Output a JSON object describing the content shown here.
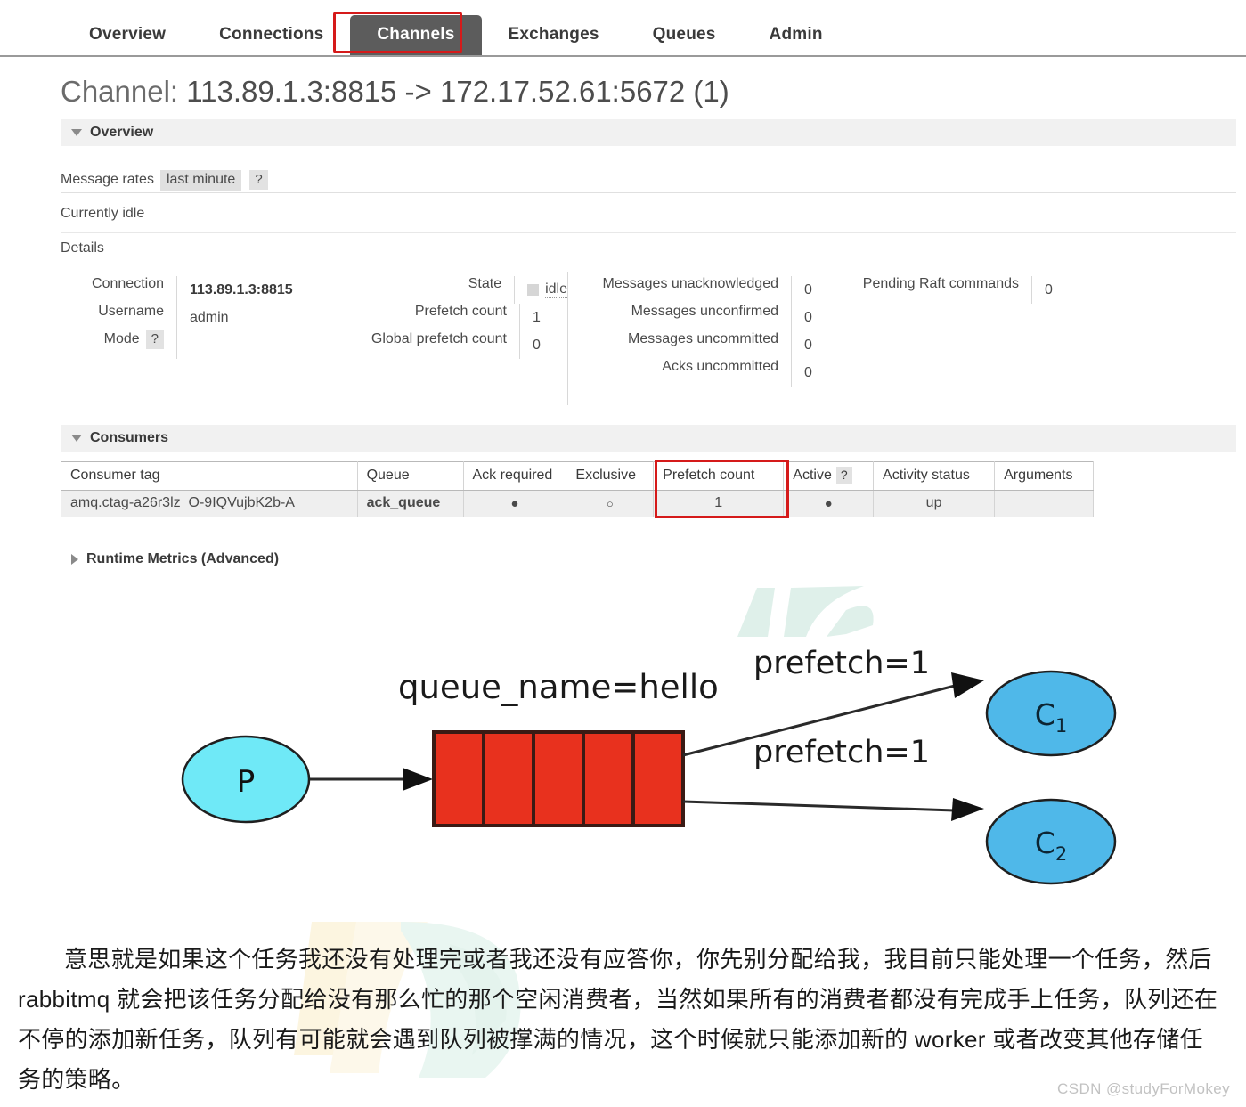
{
  "nav": {
    "tabs": [
      {
        "label": "Overview",
        "active": false
      },
      {
        "label": "Connections",
        "active": false
      },
      {
        "label": "Channels",
        "active": true
      },
      {
        "label": "Exchanges",
        "active": false
      },
      {
        "label": "Queues",
        "active": false
      },
      {
        "label": "Admin",
        "active": false
      }
    ]
  },
  "page": {
    "title_label": "Channel:",
    "title_value": "113.89.1.3:8815 -> 172.17.52.61:5672 (1)"
  },
  "overview": {
    "section_title": "Overview",
    "message_rates_label": "Message rates",
    "message_rates_period": "last minute",
    "help": "?",
    "status_line": "Currently idle",
    "details_label": "Details"
  },
  "details": {
    "col1": [
      {
        "key": "Connection",
        "value": "113.89.1.3:8815",
        "bold": true
      },
      {
        "key": "Username",
        "value": "admin",
        "bold": false
      },
      {
        "key": "Mode",
        "help": "?",
        "value": "",
        "bold": false
      }
    ],
    "col2": [
      {
        "key": "State",
        "value": "idle",
        "icon": "state-square-icon"
      },
      {
        "key": "Prefetch count",
        "value": "1"
      },
      {
        "key": "Global prefetch count",
        "value": "0"
      }
    ],
    "col3": [
      {
        "key": "Messages unacknowledged",
        "value": "0"
      },
      {
        "key": "Messages unconfirmed",
        "value": "0"
      },
      {
        "key": "Messages uncommitted",
        "value": "0"
      },
      {
        "key": "Acks uncommitted",
        "value": "0"
      }
    ],
    "col4": [
      {
        "key": "Pending Raft commands",
        "value": "0"
      }
    ]
  },
  "consumers": {
    "section_title": "Consumers",
    "headers": [
      "Consumer tag",
      "Queue",
      "Ack required",
      "Exclusive",
      "Prefetch count",
      "Active",
      "Activity status",
      "Arguments"
    ],
    "active_help": "?",
    "rows": [
      {
        "consumer_tag": "amq.ctag-a26r3lz_O-9IQVujbK2b-A",
        "queue": "ack_queue",
        "ack_required": "●",
        "exclusive": "○",
        "prefetch_count": "1",
        "active": "●",
        "activity_status": "up",
        "arguments": ""
      }
    ]
  },
  "runtime": {
    "section_title": "Runtime Metrics (Advanced)"
  },
  "diagram": {
    "queue_label": "queue_name=hello",
    "producer_label": "P",
    "edge_labels": [
      "prefetch=1",
      "prefetch=1"
    ],
    "consumers": [
      {
        "base": "C",
        "sub": "1"
      },
      {
        "base": "C",
        "sub": "2"
      }
    ],
    "queue_cells": 5,
    "colors": {
      "producer_fill": "#6FE9F7",
      "queue_fill": "#E8311E",
      "consumer_fill": "#4FB8E9",
      "stroke": "#1f1f1f"
    }
  },
  "paragraph": {
    "text": "意思就是如果这个任务我还没有处理完或者我还没有应答你，你先别分配给我，我目前只能处理一个任务，然后 rabbitmq 就会把该任务分配给没有那么忙的那个空闲消费者，当然如果所有的消费者都没有完成手上任务，队列还在不停的添加新任务，队列有可能就会遇到队列被撑满的情况，这个时候就只能添加新的 worker 或者改变其他存储任务的策略。"
  },
  "watermark": {
    "text": "CSDN @studyForMokey"
  },
  "colors": {
    "accent_red": "#d51a1a",
    "active_tab_bg": "#5c5c5c",
    "section_bg": "#f1f1f1"
  }
}
